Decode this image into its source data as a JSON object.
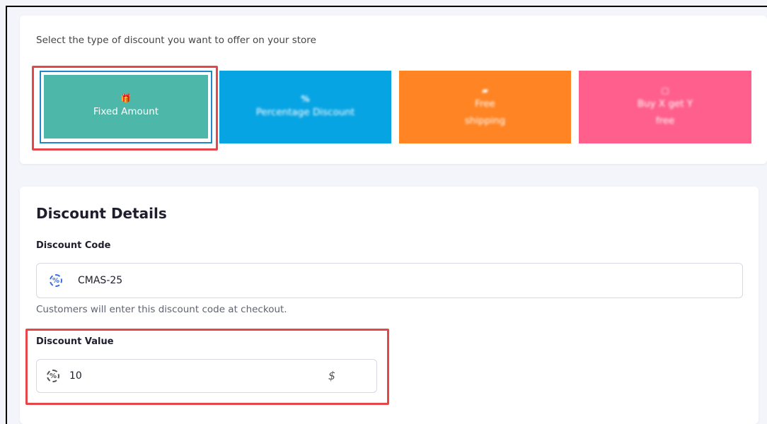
{
  "prompt": "Select the type of discount you want to offer on your store",
  "discount_types": [
    {
      "label": "Fixed Amount",
      "icon": "gift-icon",
      "icon_glyph": "🎁",
      "color": "#4db8aa",
      "selected": true
    },
    {
      "label": "Percentage Discount",
      "icon": "percent-icon",
      "icon_glyph": "%",
      "color": "#07a4e4",
      "selected": false
    },
    {
      "label_line1": "Free",
      "label_line2": "shipping",
      "icon": "truck-icon",
      "icon_glyph": "▰",
      "color": "#ff8423",
      "selected": false
    },
    {
      "label_line1": "Buy X get Y",
      "label_line2": "free",
      "icon": "tag-icon",
      "icon_glyph": "▢",
      "color": "#ff5f8c",
      "selected": false
    }
  ],
  "details": {
    "title": "Discount Details",
    "code_label": "Discount Code",
    "code_value": "CMAS-25",
    "code_help": "Customers will enter this discount code at checkout.",
    "value_label": "Discount Value",
    "value_value": "10",
    "currency_symbol": "$"
  },
  "colors": {
    "highlight": "#e5464a",
    "selected_ring": "#1e88c8",
    "input_icon_blue": "#3b6fe0"
  }
}
